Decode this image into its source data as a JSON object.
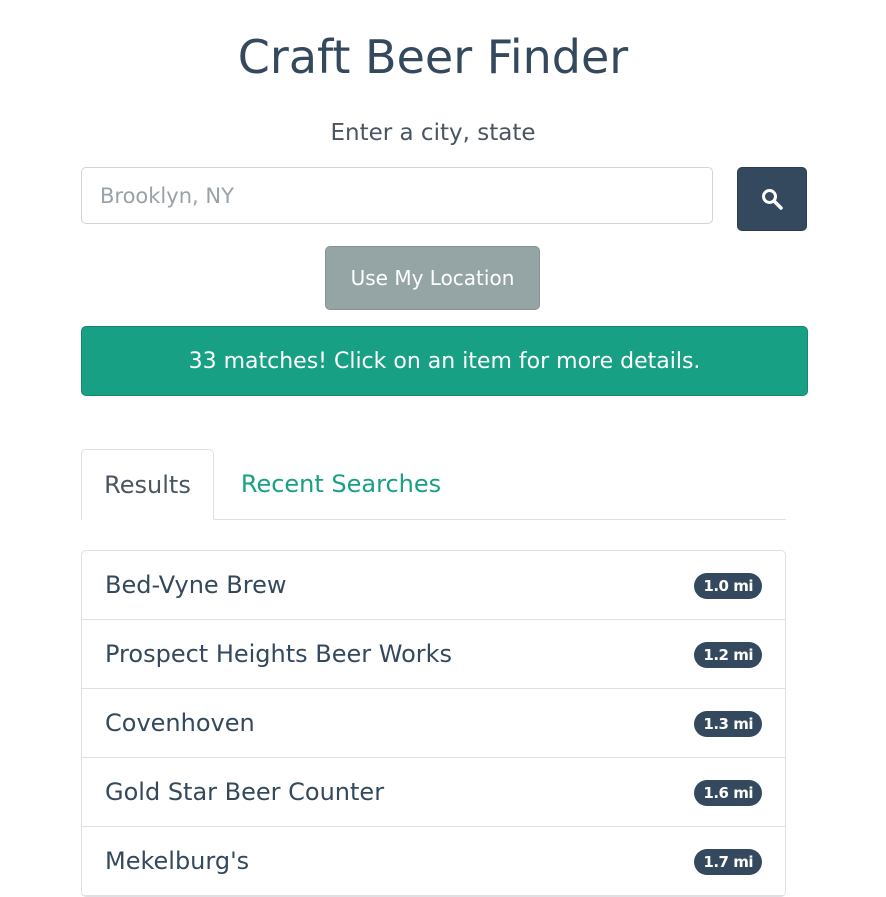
{
  "header": {
    "title": "Craft Beer Finder",
    "subtitle": "Enter a city, state"
  },
  "search": {
    "placeholder": "Brooklyn, NY",
    "value": "",
    "button_icon": "search-icon",
    "location_button_label": "Use My Location"
  },
  "alert": {
    "message": "33 matches! Click on an item for more details.",
    "color": "#18a085"
  },
  "tabs": [
    {
      "label": "Results",
      "active": true
    },
    {
      "label": "Recent Searches",
      "active": false
    }
  ],
  "results": [
    {
      "name": "Bed-Vyne Brew",
      "distance": "1.0 mi"
    },
    {
      "name": "Prospect Heights Beer Works",
      "distance": "1.2 mi"
    },
    {
      "name": "Covenhoven",
      "distance": "1.3 mi"
    },
    {
      "name": "Gold Star Beer Counter",
      "distance": "1.6 mi"
    },
    {
      "name": "Mekelburg's",
      "distance": "1.7 mi"
    }
  ],
  "colors": {
    "primary": "#34495e",
    "accent": "#18a085",
    "secondary": "#95a5a6"
  }
}
